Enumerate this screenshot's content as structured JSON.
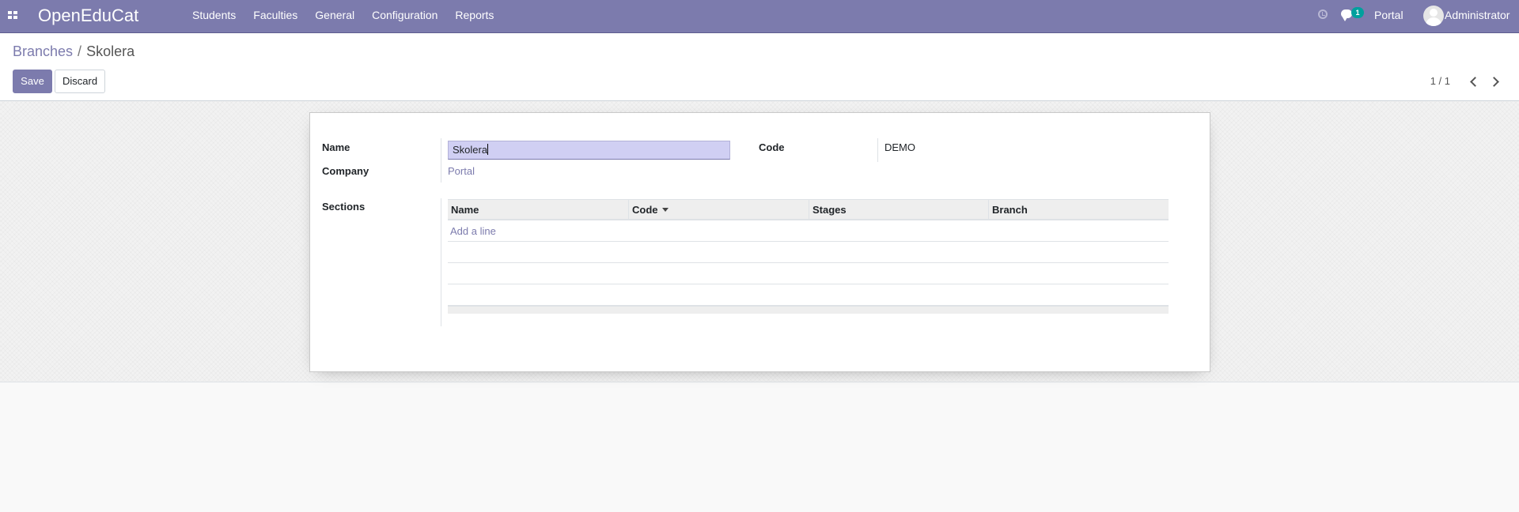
{
  "navbar": {
    "brand": "OpenEduCat",
    "menu": [
      "Students",
      "Faculties",
      "General",
      "Configuration",
      "Reports"
    ],
    "chat_count": "1",
    "portal": "Portal",
    "user": "Administrator",
    "icons": [
      "apps-icon",
      "clock-icon",
      "chat-icon",
      "avatar"
    ],
    "color": "#7c7bad"
  },
  "breadcrumb": {
    "parent": "Branches",
    "separator": "/",
    "current": "Skolera"
  },
  "buttons": {
    "save": "Save",
    "discard": "Discard"
  },
  "pager": {
    "value": "1 / 1"
  },
  "form": {
    "name_label": "Name",
    "name_value": "Skolera",
    "company_label": "Company",
    "company_value": "Portal",
    "code_label": "Code",
    "code_value": "DEMO",
    "sections_label": "Sections"
  },
  "sections_table": {
    "columns": [
      "Name",
      "Code",
      "Stages",
      "Branch"
    ],
    "sorted_column": "Code",
    "add_line": "Add a line"
  }
}
